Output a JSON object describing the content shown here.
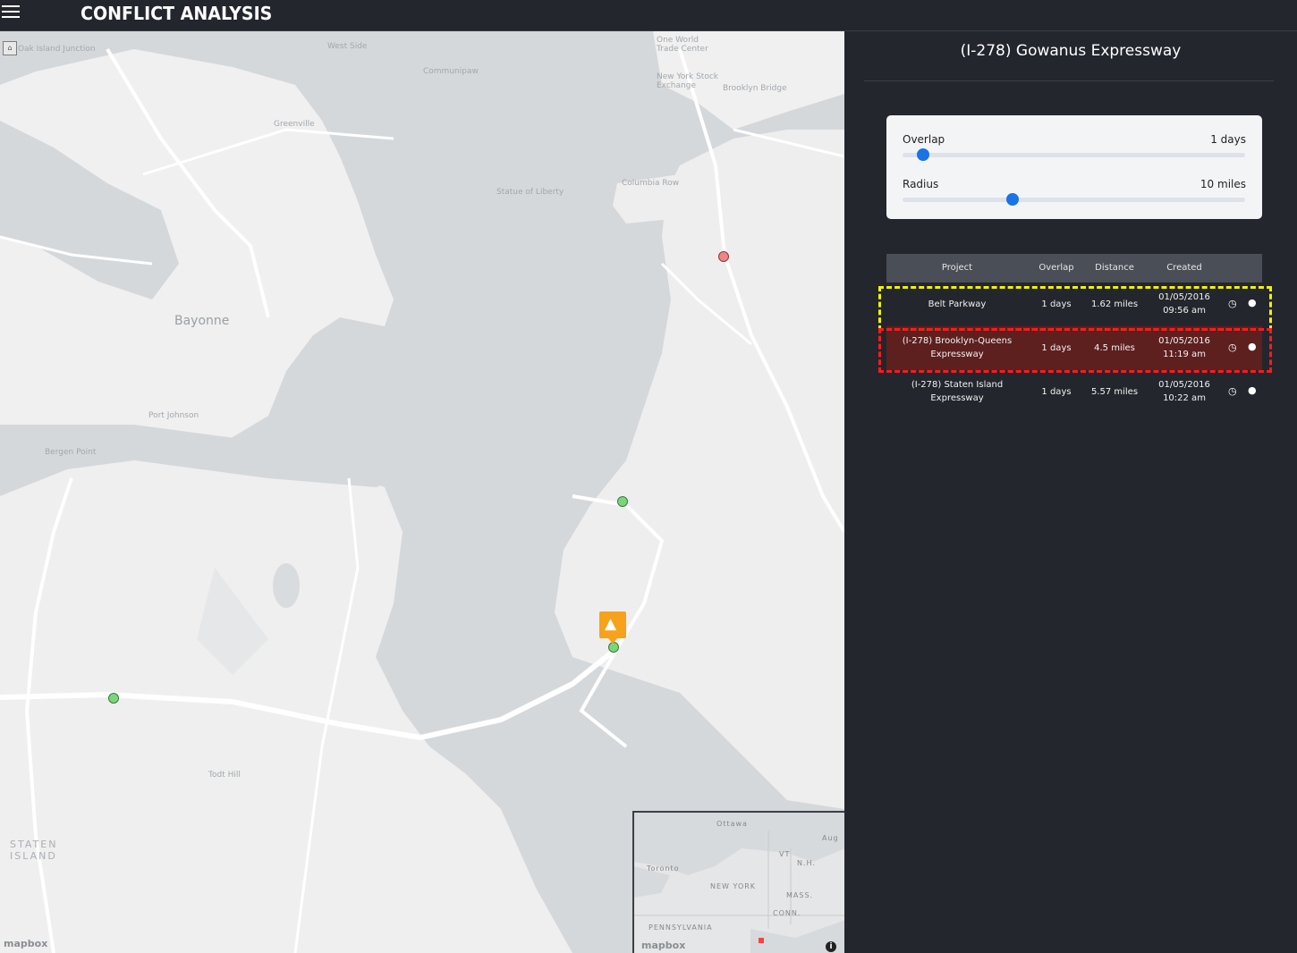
{
  "app": {
    "title": "CONFLICT ANALYSIS"
  },
  "map": {
    "labels": [
      "Oak Island Junction",
      "West Side",
      "Communipaw",
      "One World Trade Center",
      "New York Stock Exchange",
      "Brooklyn Bridge",
      "Greenville",
      "Statue of Liberty",
      "Columbia Row",
      "Bayonne",
      "Port Johnson",
      "Bergen Point",
      "Todt Hill",
      "STATEN ISLAND"
    ],
    "attribution": "mapbox",
    "minimap": {
      "labels": [
        "Ottawa",
        "Toronto",
        "Aug",
        "VT",
        "N.H.",
        "NEW YORK",
        "MASS.",
        "CONN.",
        "PENNSYLVANIA"
      ],
      "attribution": "mapbox",
      "info_glyph": "i"
    },
    "markers": {
      "green_color": "#7bd67b",
      "red_color": "#f08585",
      "cone_color": "#f7a21b"
    }
  },
  "panel": {
    "title": "(I-278) Gowanus Expressway",
    "overlap": {
      "label": "Overlap",
      "value_text": "1 days",
      "value": 1,
      "fraction": 0.06
    },
    "radius": {
      "label": "Radius",
      "value_text": "10 miles",
      "value": 10,
      "fraction": 0.32
    },
    "table": {
      "headers": [
        "Project",
        "Overlap",
        "Distance",
        "Created"
      ],
      "rows": [
        {
          "project": "Belt Parkway",
          "overlap": "1 days",
          "distance": "1.62 miles",
          "created_date": "01/05/2016",
          "created_time": "09:56 am",
          "highlight": "yellow"
        },
        {
          "project_line1": "(I-278) Brooklyn-Queens",
          "project_line2": "Expressway",
          "overlap": "1 days",
          "distance": "4.5 miles",
          "created_date": "01/05/2016",
          "created_time": "11:19 am",
          "highlight": "red"
        },
        {
          "project_line1": "(I-278) Staten Island",
          "project_line2": "Expressway",
          "overlap": "1 days",
          "distance": "5.57 miles",
          "created_date": "01/05/2016",
          "created_time": "10:22 am",
          "highlight": "none"
        }
      ],
      "icons": {
        "history": "clock-icon",
        "user": "user-icon"
      }
    }
  }
}
